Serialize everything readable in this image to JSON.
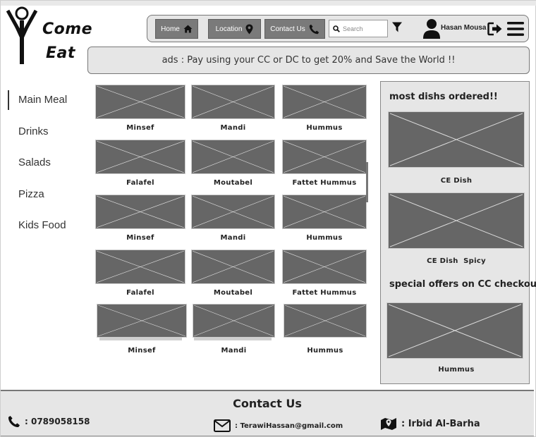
{
  "brand": {
    "line1": "Come",
    "line2": "Eat"
  },
  "nav": {
    "home_label": "Home",
    "location_label": "Location",
    "contact_label": "Contact Us",
    "search_placeholder": "Search",
    "username": "Hasan Mousa"
  },
  "ad_text": "ads : Pay using your CC or DC to get 20% and Save the World !!",
  "sidebar": {
    "items": [
      {
        "label": "Main Meal",
        "active": true
      },
      {
        "label": "Drinks"
      },
      {
        "label": "Salads"
      },
      {
        "label": "Pizza"
      },
      {
        "label": "Kids Food"
      }
    ]
  },
  "dishes": [
    "Minsef",
    "Mandi",
    "Hummus",
    "Falafel",
    "Moutabel",
    "Fattet Hummus",
    "Minsef",
    "Mandi",
    "Hummus",
    "Falafel",
    "Moutabel",
    "Fattet Hummus",
    "Minsef",
    "Mandi",
    "Hummus"
  ],
  "panel": {
    "most_ordered_title": "most dishs ordered!!",
    "most_ordered": [
      "CE Dish",
      "CE Dish  Spicy"
    ],
    "special_title": "special offers on CC checkout",
    "special": [
      "Hummus"
    ]
  },
  "footer": {
    "title": "Contact Us",
    "phone": ": 0789058158",
    "email": ": TerawiHassan@gmail.com",
    "location": ": Irbid Al-Barha"
  },
  "colors": {
    "placeholder": "#666666",
    "panel_bg": "#e6e6e6",
    "nav_button": "#7a7a7a"
  },
  "icons": [
    "logo-icon",
    "home-icon",
    "map-pin-icon",
    "phone-icon",
    "search-icon",
    "filter-icon",
    "user-icon",
    "logout-icon",
    "hamburger-menu-icon",
    "envelope-icon",
    "map-icon"
  ]
}
